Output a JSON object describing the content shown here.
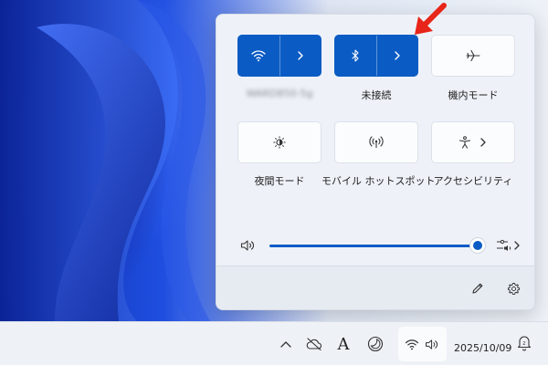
{
  "quick_settings": {
    "wifi": {
      "network_name": "WARD850-5g",
      "state": "on"
    },
    "bluetooth": {
      "label": "未接続",
      "state": "on"
    },
    "airplane": {
      "label": "機内モード",
      "state": "off"
    },
    "night_light": {
      "label": "夜間モード",
      "state": "off"
    },
    "hotspot": {
      "label": "モバイル ホットスポット",
      "state": "off"
    },
    "accessibility": {
      "label": "アクセシビリティ",
      "state": "off"
    },
    "volume": {
      "level_percent": 100
    }
  },
  "taskbar": {
    "date": "2025/10/09",
    "tray_text_icon": "A"
  },
  "colors": {
    "accent": "#0a5bc4",
    "annotation_arrow": "#e8251a"
  },
  "icons": {
    "wifi": "wifi-icon",
    "bluetooth": "bluetooth-icon",
    "airplane": "airplane-icon",
    "night_light": "brightness-icon",
    "hotspot": "hotspot-icon",
    "accessibility": "accessibility-icon",
    "speaker": "speaker-icon",
    "audio_output": "audio-output-icon",
    "edit": "pencil-icon",
    "settings": "gear-icon",
    "chevron": "chevron-right-icon"
  }
}
